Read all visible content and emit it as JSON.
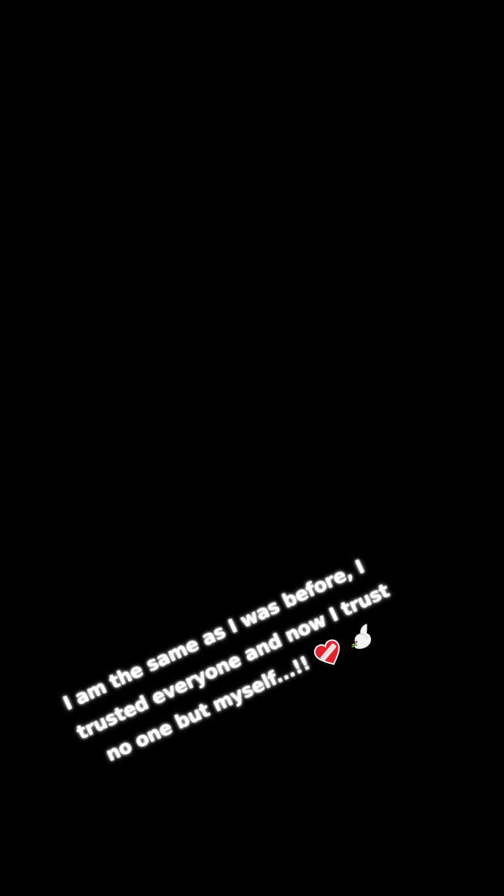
{
  "story": {
    "background_color": "#000000",
    "text_color": "#ffffff",
    "caption": {
      "line1": "I am the same as I was before, I",
      "line2": "trusted everyone and now I trust",
      "line3": "no one but myself...!!",
      "emoji_1": "mending-heart-icon",
      "emoji_2": "dove-icon"
    }
  }
}
